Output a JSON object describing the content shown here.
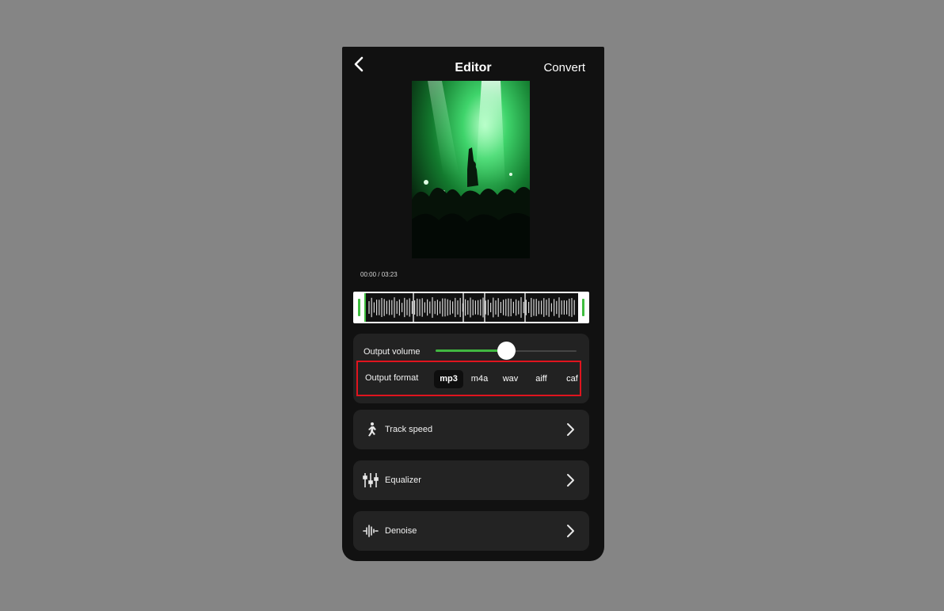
{
  "header": {
    "title": "Editor",
    "convert_label": "Convert"
  },
  "player": {
    "time": "00:00 / 03:23"
  },
  "output_volume": {
    "label": "Output volume",
    "level": 0.5
  },
  "output_format": {
    "label": "Output format",
    "options": [
      "mp3",
      "m4a",
      "wav",
      "aiff",
      "caf"
    ],
    "selected": "mp3"
  },
  "rows": [
    {
      "label": "Track speed",
      "icon": "running-icon"
    },
    {
      "label": "Equalizer",
      "icon": "equalizer-icon"
    },
    {
      "label": "Denoise",
      "icon": "denoise-icon"
    }
  ],
  "colors": {
    "accent": "#41b841",
    "highlight_border": "#e0141e"
  }
}
